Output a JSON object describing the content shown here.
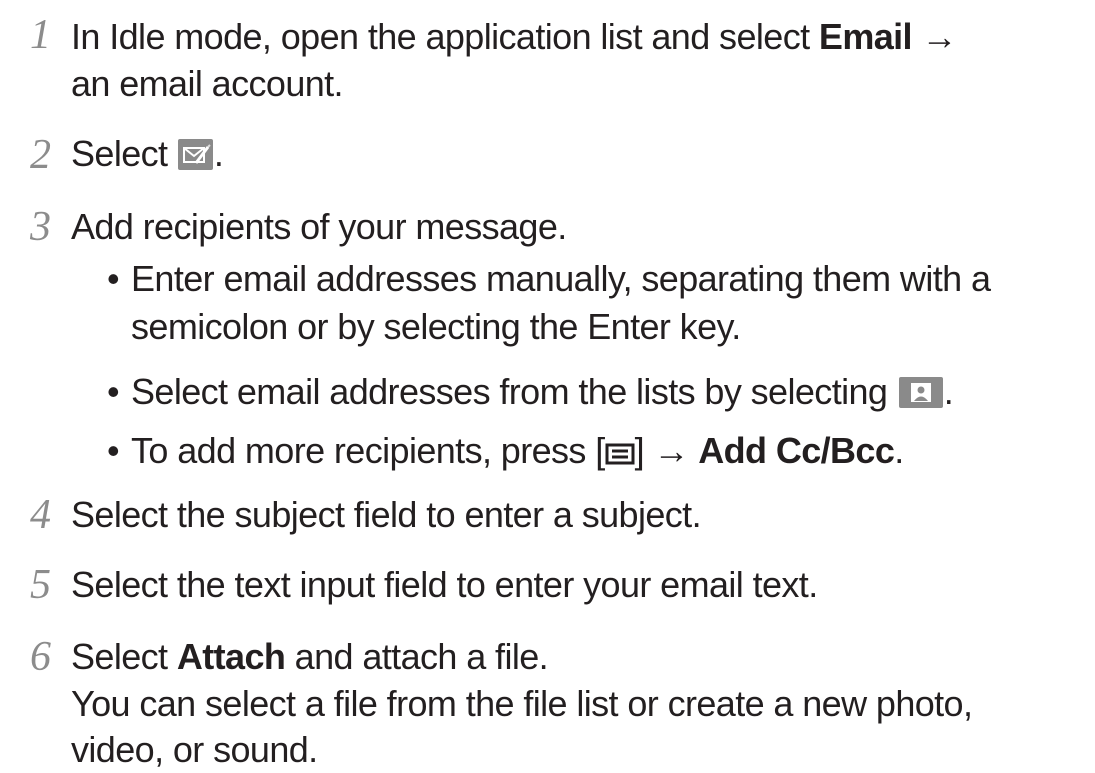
{
  "steps": [
    {
      "number": "1",
      "lines": [
        {
          "pre": "In Idle mode, open the application list and select ",
          "bold": "Email",
          "post": " →"
        },
        {
          "text": "an email account."
        }
      ]
    },
    {
      "number": "2",
      "pre": "Select ",
      "post": ".",
      "icon": "compose-email-icon"
    },
    {
      "number": "3",
      "text": "Add recipients of your message.",
      "bullets": [
        {
          "marker": "•",
          "line1": "Enter email addresses manually, separating them with a",
          "line2": "semicolon or by selecting the Enter key."
        },
        {
          "marker": "•",
          "pre": "Select email addresses from the lists by selecting ",
          "post": ".",
          "icon": "contacts-icon"
        },
        {
          "marker": "•",
          "pre": "To add more recipients, press [",
          "mid": "] → ",
          "bold": "Add Cc/Bcc",
          "post": ".",
          "icon": "menu-key-icon"
        }
      ]
    },
    {
      "number": "4",
      "text": "Select the subject field to enter a subject."
    },
    {
      "number": "5",
      "text": "Select the text input field to enter your email text."
    },
    {
      "number": "6",
      "pre": "Select ",
      "bold": "Attach",
      "post": " and attach a file.",
      "note_line1": "You can select a file from the file list or create a new photo,",
      "note_line2": "video, or sound."
    }
  ],
  "colors": {
    "text": "#231f20",
    "step_number": "#8c8c8c",
    "icon_bg": "#8a8a8a"
  }
}
